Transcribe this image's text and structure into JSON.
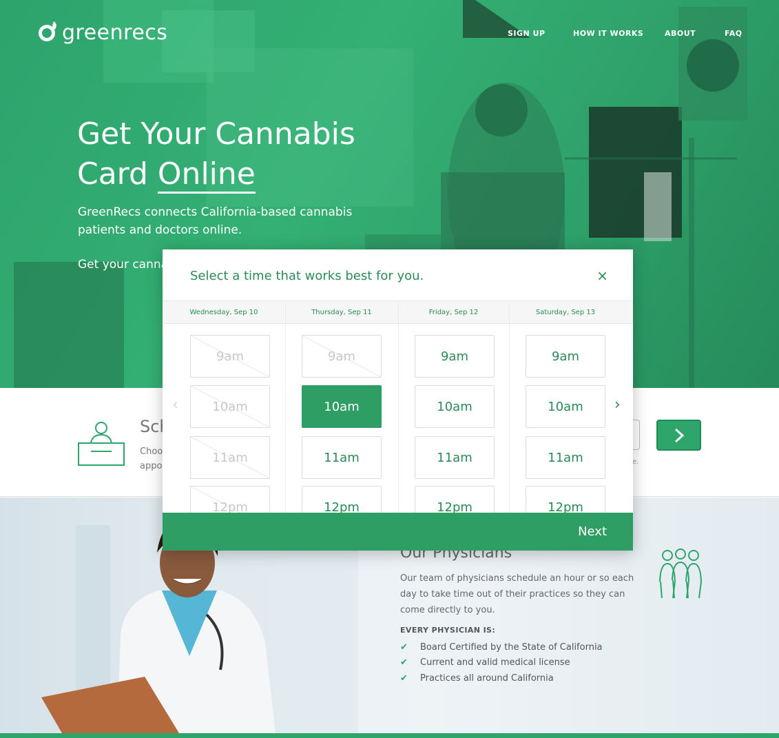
{
  "brand": {
    "name": "greenrecs"
  },
  "nav": {
    "items": [
      "SIGN UP",
      "HOW IT WORKS",
      "ABOUT",
      "FAQ"
    ]
  },
  "hero": {
    "title_line1": "Get Your Cannabis",
    "title_line2_a": "Card ",
    "title_line2_b": "Online",
    "subtitle": "GreenRecs connects California-based cannabis patients and doctors online.",
    "cta_partial": "Get your canna"
  },
  "step": {
    "title_partial": "Sch",
    "desc_line1": "Choos",
    "desc_line2": "appoi",
    "note_partial": "e."
  },
  "physicians": {
    "title": "Our Physicians",
    "body": "Our team of physicians schedule an hour or so each day to take time out of their practices so they can come directly to you.",
    "label": "EVERY PHYSICIAN IS:",
    "items": [
      "Board Certified by the State of California",
      "Current and valid medical license",
      "Practices all around California"
    ],
    "check": "✔"
  },
  "modal": {
    "title": "Select a time that works best for you.",
    "close": "×",
    "next": "Next",
    "prev_arrow": "‹",
    "next_arrow": "›",
    "days": [
      {
        "label": "Wednesday, Sep 10",
        "slots": [
          "9am",
          "10am",
          "11am",
          "12pm"
        ],
        "disabled": [
          true,
          true,
          true,
          true
        ],
        "selected": -1
      },
      {
        "label": "Thursday, Sep 11",
        "slots": [
          "9am",
          "10am",
          "11am",
          "12pm"
        ],
        "disabled": [
          true,
          false,
          false,
          false
        ],
        "selected": 1
      },
      {
        "label": "Friday, Sep 12",
        "slots": [
          "9am",
          "10am",
          "11am",
          "12pm"
        ],
        "disabled": [
          false,
          false,
          false,
          false
        ],
        "selected": -1
      },
      {
        "label": "Saturday, Sep 13",
        "slots": [
          "9am",
          "10am",
          "11am",
          "12pm"
        ],
        "disabled": [
          false,
          false,
          false,
          false
        ],
        "selected": -1
      }
    ]
  },
  "colors": {
    "brand_green": "#2e9e64",
    "dark_green": "#2a8a57"
  }
}
